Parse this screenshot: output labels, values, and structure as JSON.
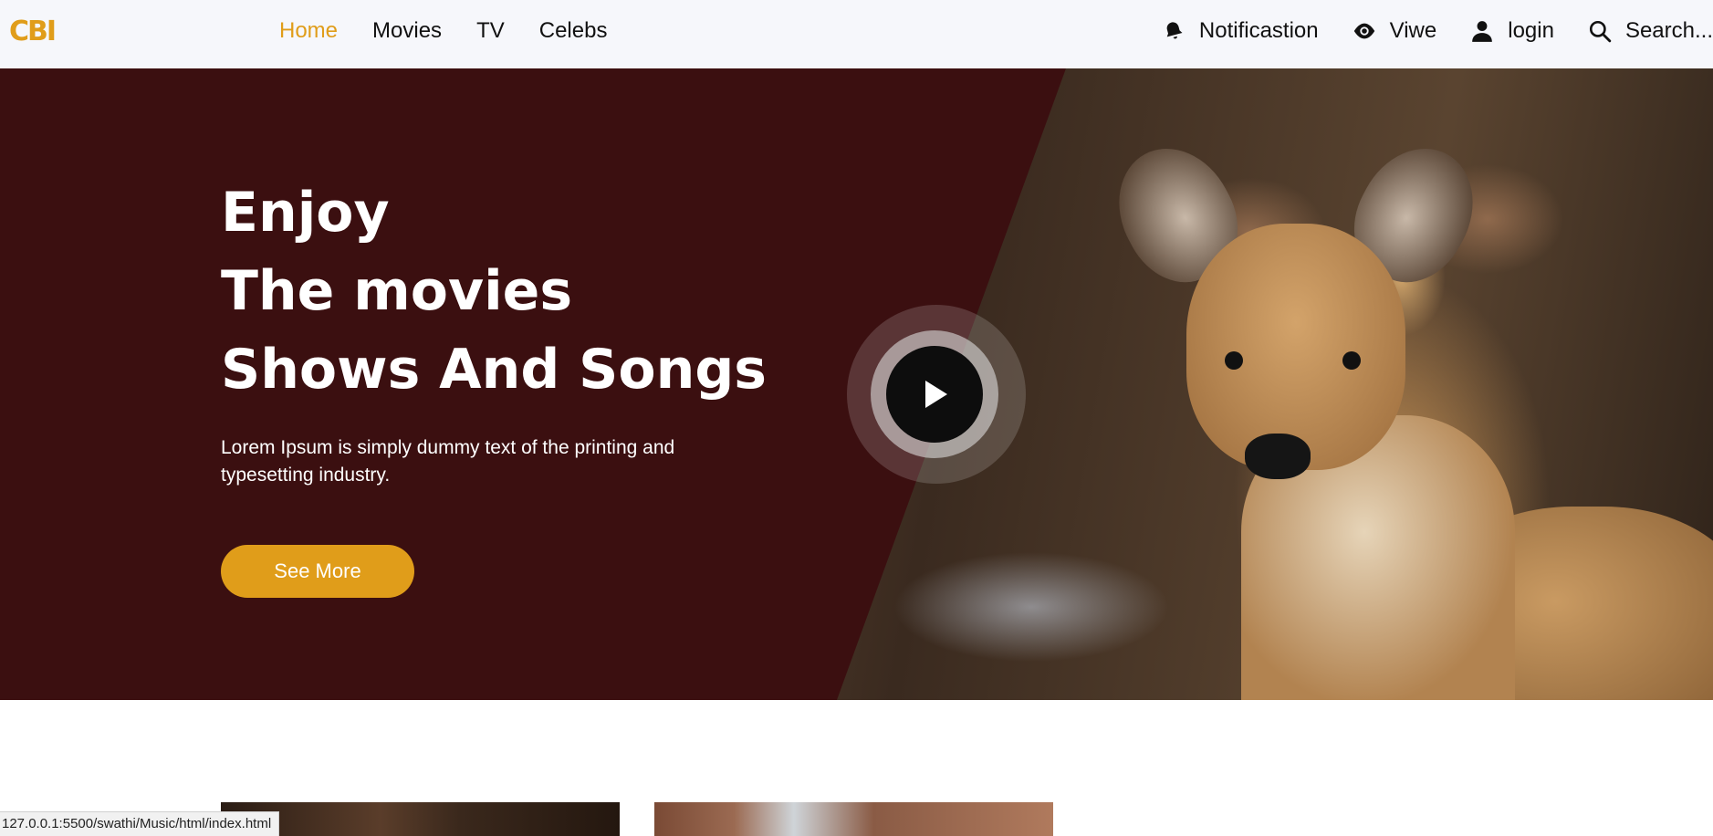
{
  "logo": {
    "text": "CBI",
    "color": "#e09d1a"
  },
  "nav": {
    "links": [
      {
        "label": "Home",
        "active": true
      },
      {
        "label": "Movies",
        "active": false
      },
      {
        "label": "TV",
        "active": false
      },
      {
        "label": "Celebs",
        "active": false
      }
    ],
    "right": {
      "notifications": {
        "label": "Notificastion",
        "icon": "bell-icon"
      },
      "view": {
        "label": "Viwe",
        "icon": "eye-icon"
      },
      "login": {
        "label": "login",
        "icon": "user-icon"
      },
      "search": {
        "label": "Search...",
        "icon": "search-icon"
      }
    }
  },
  "hero": {
    "title_lines": [
      "Enjoy",
      "The movies",
      "Shows And Songs"
    ],
    "description": "Lorem Ipsum is simply dummy text of the printing and typesetting industry.",
    "button_label": "See More",
    "background_color": "#3b0f10",
    "accent_color": "#e09d1a",
    "play_icon": "play-icon",
    "image_subject": "deer"
  },
  "cards": [
    {
      "image": "movie-thumbnail"
    },
    {
      "image": "movie-thumbnail"
    }
  ],
  "status_bar": {
    "url": "127.0.0.1:5500/swathi/Music/html/index.html"
  }
}
